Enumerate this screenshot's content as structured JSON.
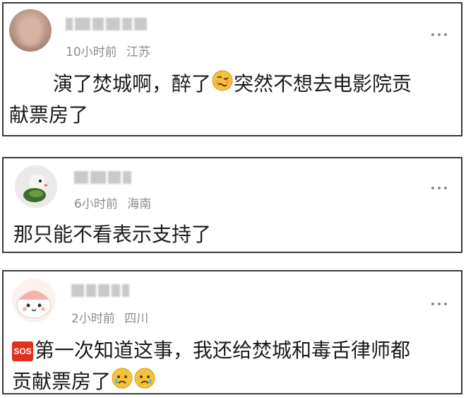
{
  "comments": [
    {
      "time": "10小时前",
      "location": "江苏",
      "text_lines": [
        "演了焚城啊，醉了",
        "突然不想去电影院贡",
        "献票房了"
      ],
      "emoji": "woozy-face-icon"
    },
    {
      "time": "6小时前",
      "location": "海南",
      "text_lines": [
        "那只能不看表示支持了"
      ]
    },
    {
      "time": "2小时前",
      "location": "四川",
      "sos_badge": "SOS",
      "text_lines": [
        "第一次知道这事，我还给焚城和毒舌律师都",
        "贡献票房了"
      ],
      "emoji": "sad-relieved-face-icon"
    }
  ]
}
